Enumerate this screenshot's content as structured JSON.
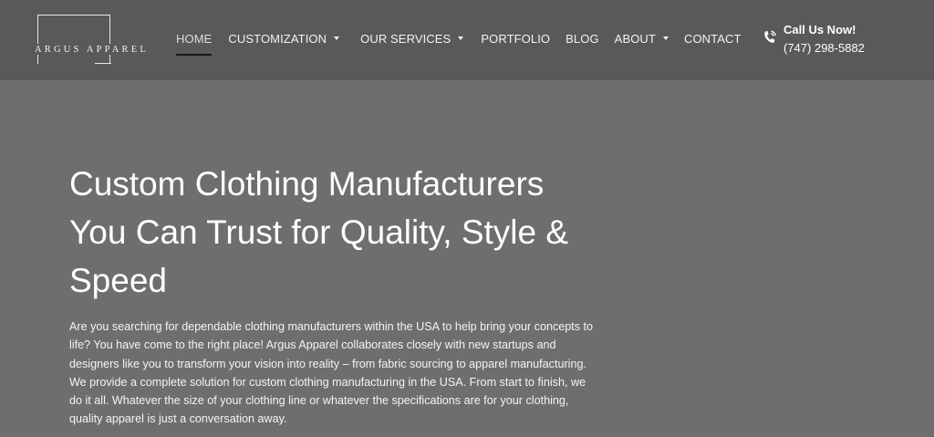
{
  "brand": {
    "logo_text": "ARGUS APPAREL"
  },
  "nav": {
    "items": [
      {
        "label": "HOME",
        "active": true,
        "has_dropdown": false
      },
      {
        "label": "CUSTOMIZATION",
        "active": false,
        "has_dropdown": true
      },
      {
        "label": "OUR SERVICES",
        "active": false,
        "has_dropdown": true
      },
      {
        "label": "PORTFOLIO",
        "active": false,
        "has_dropdown": false
      },
      {
        "label": "BLOG",
        "active": false,
        "has_dropdown": false
      },
      {
        "label": "ABOUT",
        "active": false,
        "has_dropdown": true
      },
      {
        "label": "CONTACT",
        "active": false,
        "has_dropdown": false
      }
    ],
    "dropdown_icon": "caret-down-icon"
  },
  "call": {
    "title": "Call Us Now!",
    "number": "(747) 298-5882",
    "icon": "phone-icon"
  },
  "hero": {
    "title": "Custom Clothing Manufacturers You Can Trust for Quality, Style & Speed",
    "text": "Are you searching for dependable clothing manufacturers within the USA to help bring your concepts to life? You have come to the right place! Argus Apparel collaborates closely with new startups and designers like you to transform your vision into reality – from fabric sourcing to apparel manufacturing. We provide a complete solution for custom clothing manufacturing in the USA. From start to finish, we do it all. Whatever the size of your clothing line or whatever the specifications are for your clothing, quality apparel is just a conversation away."
  },
  "colors": {
    "header_bg": "#595959",
    "page_bg": "#6e6e6e",
    "text": "#ffffff",
    "active_underline": "#1a1a1a"
  }
}
